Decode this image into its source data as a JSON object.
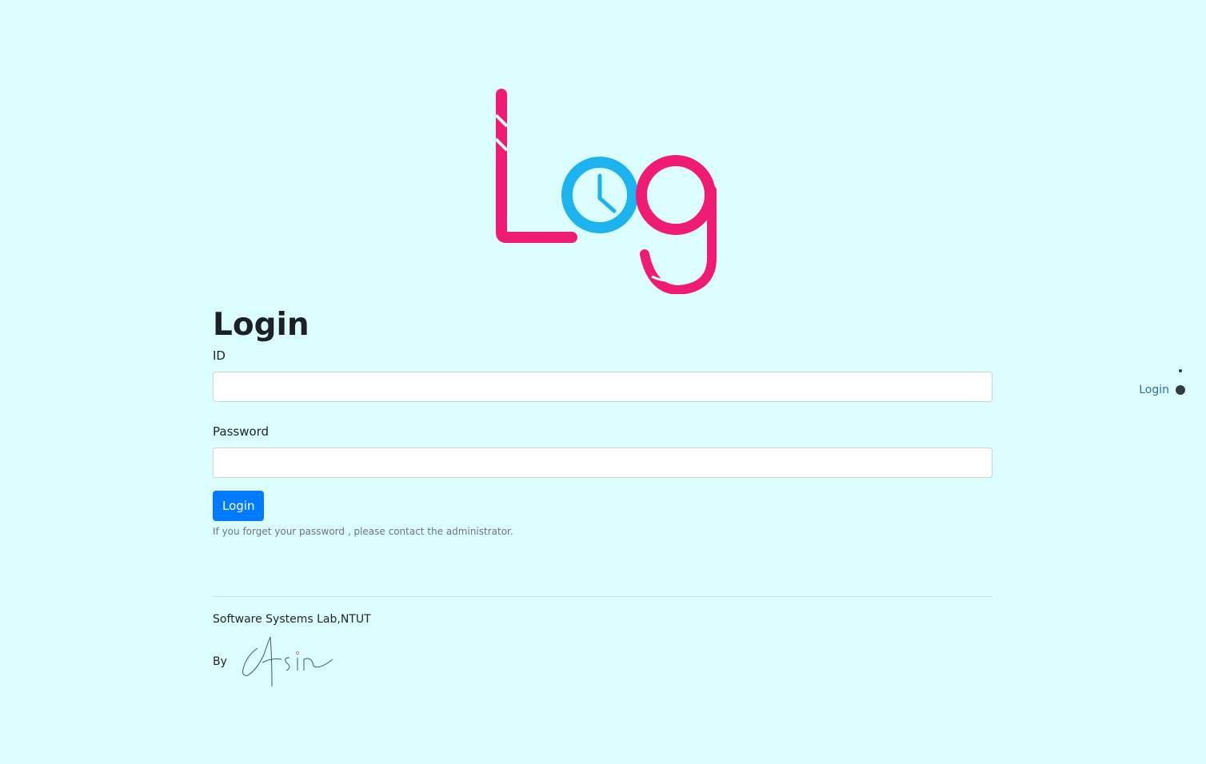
{
  "logo": {
    "alt_text": "Log"
  },
  "login_form": {
    "title": "Login",
    "id_label": "ID",
    "id_value": "",
    "password_label": "Password",
    "password_value": "",
    "submit_label": "Login",
    "hint": "If you forget your password , please contact the administrator."
  },
  "footer": {
    "lab": "Software Systems Lab,NTUT",
    "by_label": "By",
    "signature_text": "Afsin"
  },
  "side_nav": {
    "items": [
      {
        "label": "Login",
        "active": true
      }
    ]
  },
  "colors": {
    "background": "#dcfdfd",
    "primary_button": "#007bff",
    "logo_pink": "#f01b74",
    "logo_blue": "#1db3ee"
  }
}
